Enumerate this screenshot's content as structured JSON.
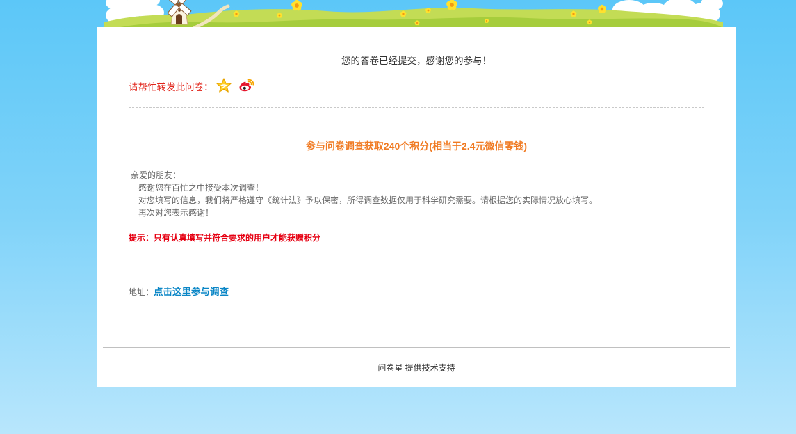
{
  "result": {
    "submitted_message": "您的答卷已经提交，感谢您的参与！"
  },
  "share": {
    "label": "请帮忙转发此问卷：",
    "icons": [
      "qzone-icon",
      "weibo-icon"
    ]
  },
  "promo": {
    "title": "参与问卷调查获取240个积分(相当于2.4元微信零钱)",
    "greeting": "亲爱的朋友：",
    "lines": [
      "感谢您在百忙之中接受本次调查！",
      "对您填写的信息，我们将严格遵守《统计法》予以保密，所得调查数据仅用于科学研究需要。请根据您的实际情况放心填写。",
      "再次对您表示感谢！"
    ],
    "tip": "提示：只有认真填写并符合要求的用户才能获赠积分",
    "address_label": "地址：",
    "link_text": "点击这里参与调查"
  },
  "footer": {
    "brand": "问卷星",
    "text": "提供技术支持"
  },
  "colors": {
    "share_label": "#e1251b",
    "promo_title": "#f07a22",
    "tip": "#e60012",
    "link": "#0a86c6"
  }
}
